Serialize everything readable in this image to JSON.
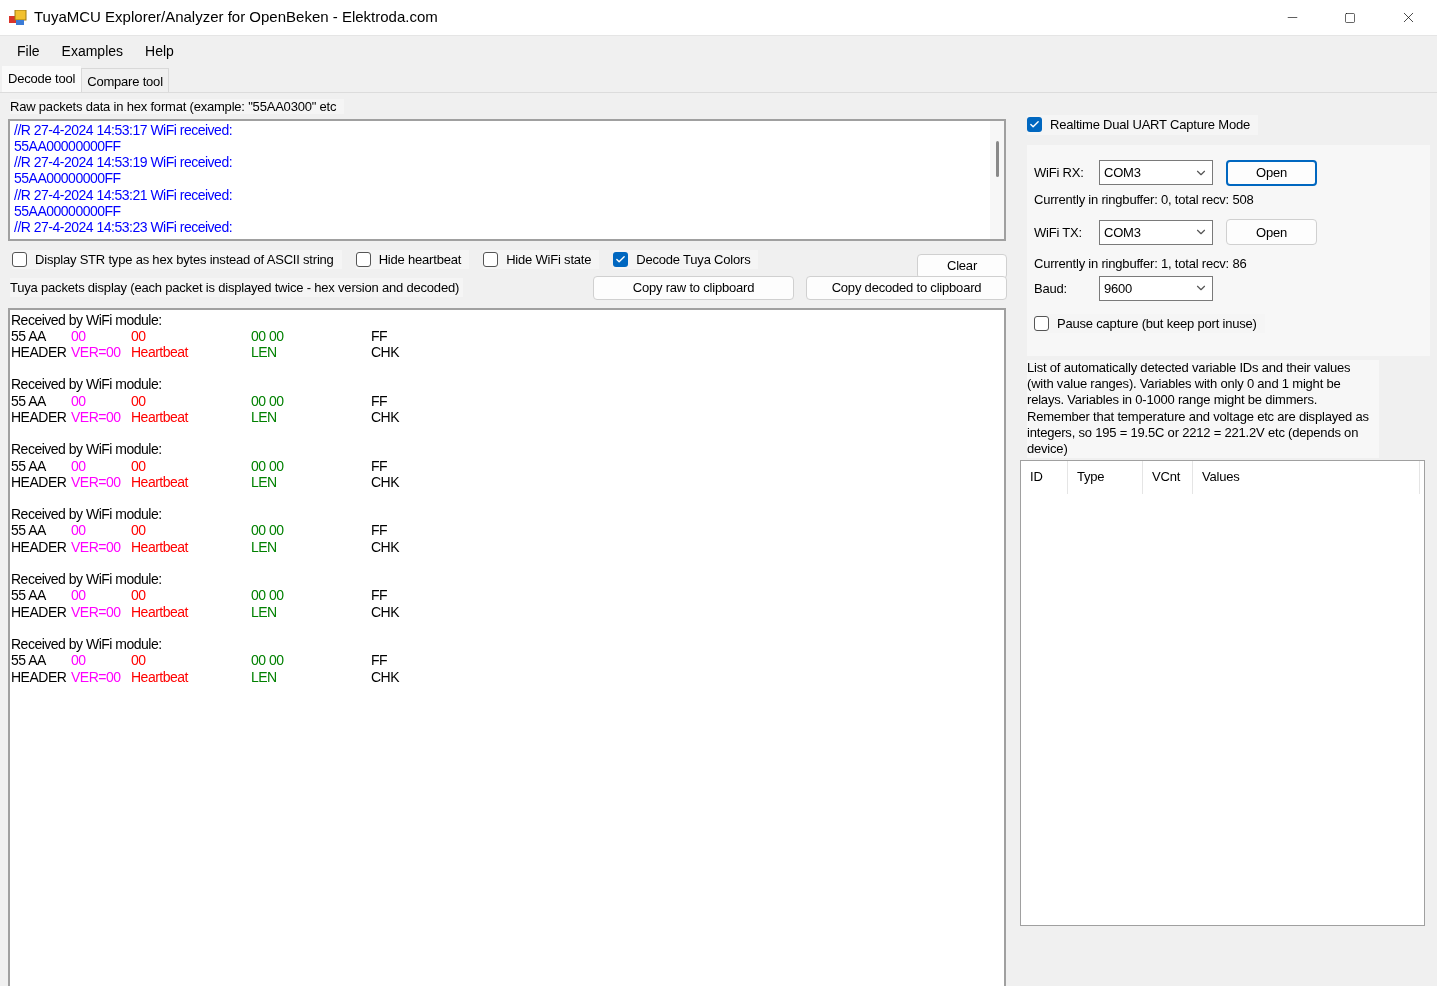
{
  "window": {
    "title": "TuyaMCU Explorer/Analyzer for OpenBeken - Elektroda.com"
  },
  "menu": [
    "File",
    "Examples",
    "Help"
  ],
  "tabs": [
    {
      "label": "Decode tool",
      "selected": true
    },
    {
      "label": "Compare tool",
      "selected": false
    }
  ],
  "raw_label": "Raw packets data in hex format (example: \"55AA0300\" etc",
  "raw_lines": [
    "//R 27-4-2024 14:53:17 WiFi received:",
    "55AA00000000FF",
    "//R 27-4-2024 14:53:19 WiFi received:",
    "55AA00000000FF",
    "//R 27-4-2024 14:53:21 WiFi received:",
    "55AA00000000FF",
    "//R 27-4-2024 14:53:23 WiFi received:"
  ],
  "options": [
    {
      "label": "Display STR type as hex bytes instead of ASCII string",
      "checked": false
    },
    {
      "label": "Hide heartbeat",
      "checked": false
    },
    {
      "label": "Hide WiFi state",
      "checked": false
    },
    {
      "label": "Decode Tuya Colors",
      "checked": true
    }
  ],
  "clear_button": "Clear",
  "decoded_label": "Tuya packets display (each packet is displayed twice - hex version and decoded)",
  "copy_buttons": [
    "Copy raw to clipboard",
    "Copy decoded to clipboard"
  ],
  "packets": [
    {
      "title": "Received by WiFi module:",
      "fields": [
        {
          "hex": "55 AA",
          "label": "HEADER",
          "color": "#000000"
        },
        {
          "hex": "00",
          "label": "VER=00",
          "color": "#ff00ff"
        },
        {
          "hex": "00",
          "label": "Heartbeat",
          "color": "#ff0000"
        },
        {
          "hex": "00 00",
          "label": "LEN",
          "color": "#008000"
        },
        {
          "hex": "FF",
          "label": "CHK",
          "color": "#000000"
        }
      ]
    },
    {
      "title": "Received by WiFi module:",
      "fields": [
        {
          "hex": "55 AA",
          "label": "HEADER",
          "color": "#000000"
        },
        {
          "hex": "00",
          "label": "VER=00",
          "color": "#ff00ff"
        },
        {
          "hex": "00",
          "label": "Heartbeat",
          "color": "#ff0000"
        },
        {
          "hex": "00 00",
          "label": "LEN",
          "color": "#008000"
        },
        {
          "hex": "FF",
          "label": "CHK",
          "color": "#000000"
        }
      ]
    },
    {
      "title": "Received by WiFi module:",
      "fields": [
        {
          "hex": "55 AA",
          "label": "HEADER",
          "color": "#000000"
        },
        {
          "hex": "00",
          "label": "VER=00",
          "color": "#ff00ff"
        },
        {
          "hex": "00",
          "label": "Heartbeat",
          "color": "#ff0000"
        },
        {
          "hex": "00 00",
          "label": "LEN",
          "color": "#008000"
        },
        {
          "hex": "FF",
          "label": "CHK",
          "color": "#000000"
        }
      ]
    },
    {
      "title": "Received by WiFi module:",
      "fields": [
        {
          "hex": "55 AA",
          "label": "HEADER",
          "color": "#000000"
        },
        {
          "hex": "00",
          "label": "VER=00",
          "color": "#ff00ff"
        },
        {
          "hex": "00",
          "label": "Heartbeat",
          "color": "#ff0000"
        },
        {
          "hex": "00 00",
          "label": "LEN",
          "color": "#008000"
        },
        {
          "hex": "FF",
          "label": "CHK",
          "color": "#000000"
        }
      ]
    },
    {
      "title": "Received by WiFi module:",
      "fields": [
        {
          "hex": "55 AA",
          "label": "HEADER",
          "color": "#000000"
        },
        {
          "hex": "00",
          "label": "VER=00",
          "color": "#ff00ff"
        },
        {
          "hex": "00",
          "label": "Heartbeat",
          "color": "#ff0000"
        },
        {
          "hex": "00 00",
          "label": "LEN",
          "color": "#008000"
        },
        {
          "hex": "FF",
          "label": "CHK",
          "color": "#000000"
        }
      ]
    },
    {
      "title": "Received by WiFi module:",
      "fields": [
        {
          "hex": "55 AA",
          "label": "HEADER",
          "color": "#000000"
        },
        {
          "hex": "00",
          "label": "VER=00",
          "color": "#ff00ff"
        },
        {
          "hex": "00",
          "label": "Heartbeat",
          "color": "#ff0000"
        },
        {
          "hex": "00 00",
          "label": "LEN",
          "color": "#008000"
        },
        {
          "hex": "FF",
          "label": "CHK",
          "color": "#000000"
        }
      ]
    }
  ],
  "capture": {
    "label": "Realtime Dual UART Capture Mode",
    "checked": true,
    "rx": {
      "label": "WiFi RX:",
      "port": "COM3",
      "button": "Open",
      "focused": true,
      "status": "Currently in ringbuffer: 0, total recv: 508"
    },
    "tx": {
      "label": "WiFi TX:",
      "port": "COM3",
      "button": "Open",
      "focused": false,
      "status": "Currently in ringbuffer: 1, total recv: 86"
    },
    "baud": {
      "label": "Baud:",
      "value": "9600"
    },
    "pause": {
      "label": "Pause capture (but keep port inuse)",
      "checked": false
    }
  },
  "variables_note": "List of automatically detected variable IDs  and their values (with value ranges). Variables with only 0 and 1 might be relays. Variables in 0-1000 range might be dimmers. Remember that temperature and voltage etc are displayed as integers, so 195 = 19.5C or 2212 = 221.2V etc (depends on device)",
  "table": {
    "columns": [
      "ID",
      "Type",
      "VCnt",
      "Values"
    ]
  }
}
